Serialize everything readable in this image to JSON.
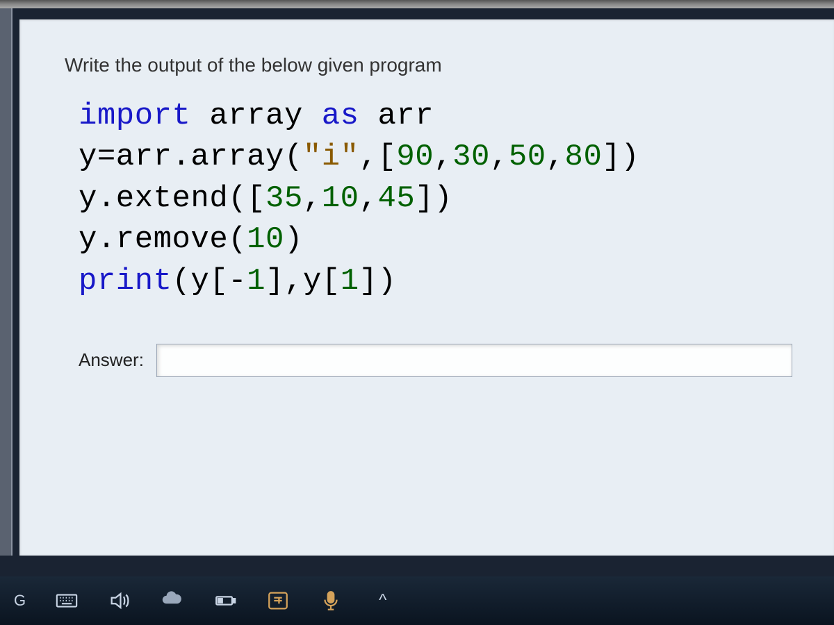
{
  "question": {
    "prompt": "Write the output of the below given program",
    "code": {
      "line1": {
        "kw1": "import",
        "plain1": " array ",
        "kw2": "as",
        "plain2": " arr"
      },
      "line2": {
        "plain1": "y=arr.array(",
        "str1": "\"i\"",
        "plain2": ",[",
        "n1": "90",
        "c1": ",",
        "n2": "30",
        "c2": ",",
        "n3": "50",
        "c3": ",",
        "n4": "80",
        "plain3": "])"
      },
      "line3": {
        "plain1": "y.extend([",
        "n1": "35",
        "c1": ",",
        "n2": "10",
        "c2": ",",
        "n3": "45",
        "plain2": "])"
      },
      "line4": {
        "plain1": "y.remove(",
        "n1": "10",
        "plain2": ")"
      },
      "line5": {
        "kw1": "print",
        "plain1": "(y[-",
        "n1": "1",
        "plain2": "],y[",
        "n2": "1",
        "plain3": "])"
      }
    },
    "answer_label": "Answer:",
    "answer_value": ""
  },
  "taskbar": {
    "touch_keyboard": "keyboard-icon",
    "volume": "volume-icon",
    "weather": "weather-icon",
    "battery": "battery-icon",
    "ime": "ime-icon",
    "mic": "mic-icon",
    "caret": "^"
  }
}
